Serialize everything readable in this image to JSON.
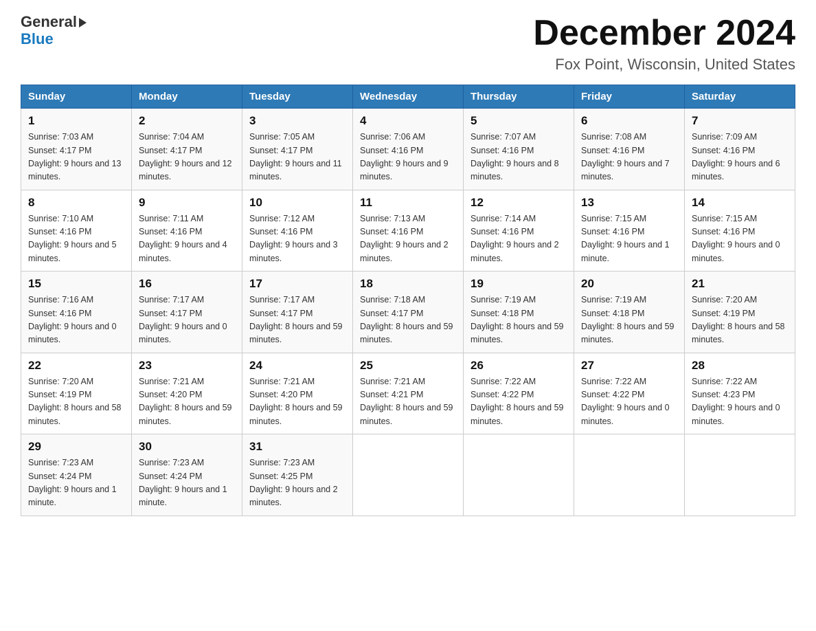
{
  "header": {
    "logo_general": "General",
    "logo_blue": "Blue",
    "month_title": "December 2024",
    "location": "Fox Point, Wisconsin, United States"
  },
  "weekdays": [
    "Sunday",
    "Monday",
    "Tuesday",
    "Wednesday",
    "Thursday",
    "Friday",
    "Saturday"
  ],
  "weeks": [
    [
      {
        "day": "1",
        "sunrise": "7:03 AM",
        "sunset": "4:17 PM",
        "daylight": "9 hours and 13 minutes."
      },
      {
        "day": "2",
        "sunrise": "7:04 AM",
        "sunset": "4:17 PM",
        "daylight": "9 hours and 12 minutes."
      },
      {
        "day": "3",
        "sunrise": "7:05 AM",
        "sunset": "4:17 PM",
        "daylight": "9 hours and 11 minutes."
      },
      {
        "day": "4",
        "sunrise": "7:06 AM",
        "sunset": "4:16 PM",
        "daylight": "9 hours and 9 minutes."
      },
      {
        "day": "5",
        "sunrise": "7:07 AM",
        "sunset": "4:16 PM",
        "daylight": "9 hours and 8 minutes."
      },
      {
        "day": "6",
        "sunrise": "7:08 AM",
        "sunset": "4:16 PM",
        "daylight": "9 hours and 7 minutes."
      },
      {
        "day": "7",
        "sunrise": "7:09 AM",
        "sunset": "4:16 PM",
        "daylight": "9 hours and 6 minutes."
      }
    ],
    [
      {
        "day": "8",
        "sunrise": "7:10 AM",
        "sunset": "4:16 PM",
        "daylight": "9 hours and 5 minutes."
      },
      {
        "day": "9",
        "sunrise": "7:11 AM",
        "sunset": "4:16 PM",
        "daylight": "9 hours and 4 minutes."
      },
      {
        "day": "10",
        "sunrise": "7:12 AM",
        "sunset": "4:16 PM",
        "daylight": "9 hours and 3 minutes."
      },
      {
        "day": "11",
        "sunrise": "7:13 AM",
        "sunset": "4:16 PM",
        "daylight": "9 hours and 2 minutes."
      },
      {
        "day": "12",
        "sunrise": "7:14 AM",
        "sunset": "4:16 PM",
        "daylight": "9 hours and 2 minutes."
      },
      {
        "day": "13",
        "sunrise": "7:15 AM",
        "sunset": "4:16 PM",
        "daylight": "9 hours and 1 minute."
      },
      {
        "day": "14",
        "sunrise": "7:15 AM",
        "sunset": "4:16 PM",
        "daylight": "9 hours and 0 minutes."
      }
    ],
    [
      {
        "day": "15",
        "sunrise": "7:16 AM",
        "sunset": "4:16 PM",
        "daylight": "9 hours and 0 minutes."
      },
      {
        "day": "16",
        "sunrise": "7:17 AM",
        "sunset": "4:17 PM",
        "daylight": "9 hours and 0 minutes."
      },
      {
        "day": "17",
        "sunrise": "7:17 AM",
        "sunset": "4:17 PM",
        "daylight": "8 hours and 59 minutes."
      },
      {
        "day": "18",
        "sunrise": "7:18 AM",
        "sunset": "4:17 PM",
        "daylight": "8 hours and 59 minutes."
      },
      {
        "day": "19",
        "sunrise": "7:19 AM",
        "sunset": "4:18 PM",
        "daylight": "8 hours and 59 minutes."
      },
      {
        "day": "20",
        "sunrise": "7:19 AM",
        "sunset": "4:18 PM",
        "daylight": "8 hours and 59 minutes."
      },
      {
        "day": "21",
        "sunrise": "7:20 AM",
        "sunset": "4:19 PM",
        "daylight": "8 hours and 58 minutes."
      }
    ],
    [
      {
        "day": "22",
        "sunrise": "7:20 AM",
        "sunset": "4:19 PM",
        "daylight": "8 hours and 58 minutes."
      },
      {
        "day": "23",
        "sunrise": "7:21 AM",
        "sunset": "4:20 PM",
        "daylight": "8 hours and 59 minutes."
      },
      {
        "day": "24",
        "sunrise": "7:21 AM",
        "sunset": "4:20 PM",
        "daylight": "8 hours and 59 minutes."
      },
      {
        "day": "25",
        "sunrise": "7:21 AM",
        "sunset": "4:21 PM",
        "daylight": "8 hours and 59 minutes."
      },
      {
        "day": "26",
        "sunrise": "7:22 AM",
        "sunset": "4:22 PM",
        "daylight": "8 hours and 59 minutes."
      },
      {
        "day": "27",
        "sunrise": "7:22 AM",
        "sunset": "4:22 PM",
        "daylight": "9 hours and 0 minutes."
      },
      {
        "day": "28",
        "sunrise": "7:22 AM",
        "sunset": "4:23 PM",
        "daylight": "9 hours and 0 minutes."
      }
    ],
    [
      {
        "day": "29",
        "sunrise": "7:23 AM",
        "sunset": "4:24 PM",
        "daylight": "9 hours and 1 minute."
      },
      {
        "day": "30",
        "sunrise": "7:23 AM",
        "sunset": "4:24 PM",
        "daylight": "9 hours and 1 minute."
      },
      {
        "day": "31",
        "sunrise": "7:23 AM",
        "sunset": "4:25 PM",
        "daylight": "9 hours and 2 minutes."
      },
      null,
      null,
      null,
      null
    ]
  ],
  "labels": {
    "sunrise": "Sunrise:",
    "sunset": "Sunset:",
    "daylight": "Daylight:"
  }
}
